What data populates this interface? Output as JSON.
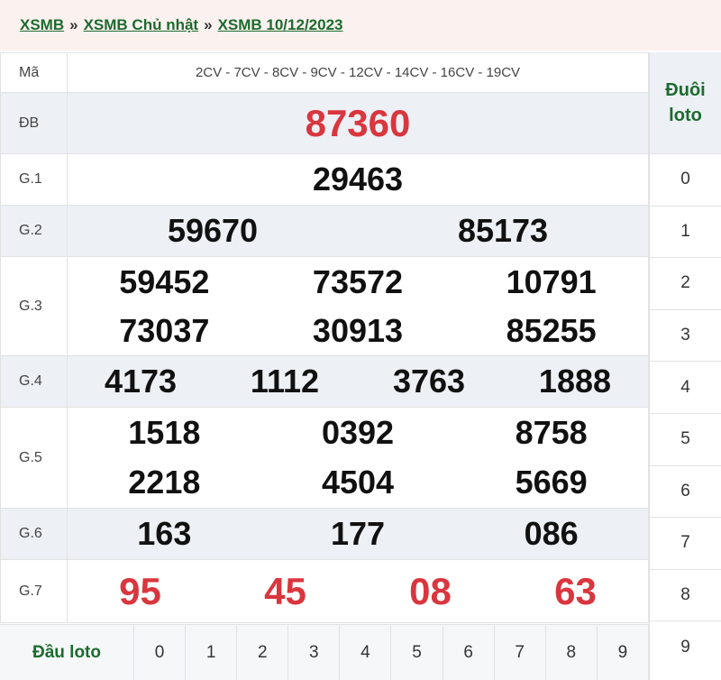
{
  "breadcrumb": [
    "XSMB",
    "XSMB Chủ nhật",
    "XSMB 10/12/2023"
  ],
  "separator": "»",
  "ma": {
    "label": "Mã",
    "value": "2CV - 7CV - 8CV - 9CV - 12CV - 14CV - 16CV - 19CV"
  },
  "prizes": {
    "db": {
      "label": "ĐB",
      "numbers": [
        "87360"
      ]
    },
    "g1": {
      "label": "G.1",
      "numbers": [
        "29463"
      ]
    },
    "g2": {
      "label": "G.2",
      "numbers": [
        "59670",
        "85173"
      ]
    },
    "g3": {
      "label": "G.3",
      "numbers": [
        "59452",
        "73572",
        "10791",
        "73037",
        "30913",
        "85255"
      ]
    },
    "g4": {
      "label": "G.4",
      "numbers": [
        "4173",
        "1112",
        "3763",
        "1888"
      ]
    },
    "g5": {
      "label": "G.5",
      "numbers": [
        "1518",
        "0392",
        "8758",
        "2218",
        "4504",
        "5669"
      ]
    },
    "g6": {
      "label": "G.6",
      "numbers": [
        "163",
        "177",
        "086"
      ]
    },
    "g7": {
      "label": "G.7",
      "numbers": [
        "95",
        "45",
        "08",
        "63"
      ]
    }
  },
  "dau_loto": {
    "label": "Đầu loto",
    "digits": [
      "0",
      "1",
      "2",
      "3",
      "4",
      "5",
      "6",
      "7",
      "8",
      "9"
    ]
  },
  "duoi_loto": {
    "label": "Đuôi loto",
    "digits": [
      "0",
      "1",
      "2",
      "3",
      "4",
      "5",
      "6",
      "7",
      "8",
      "9"
    ]
  },
  "colors": {
    "accent_green": "#1c6b2e",
    "special_red": "#d9363e"
  }
}
